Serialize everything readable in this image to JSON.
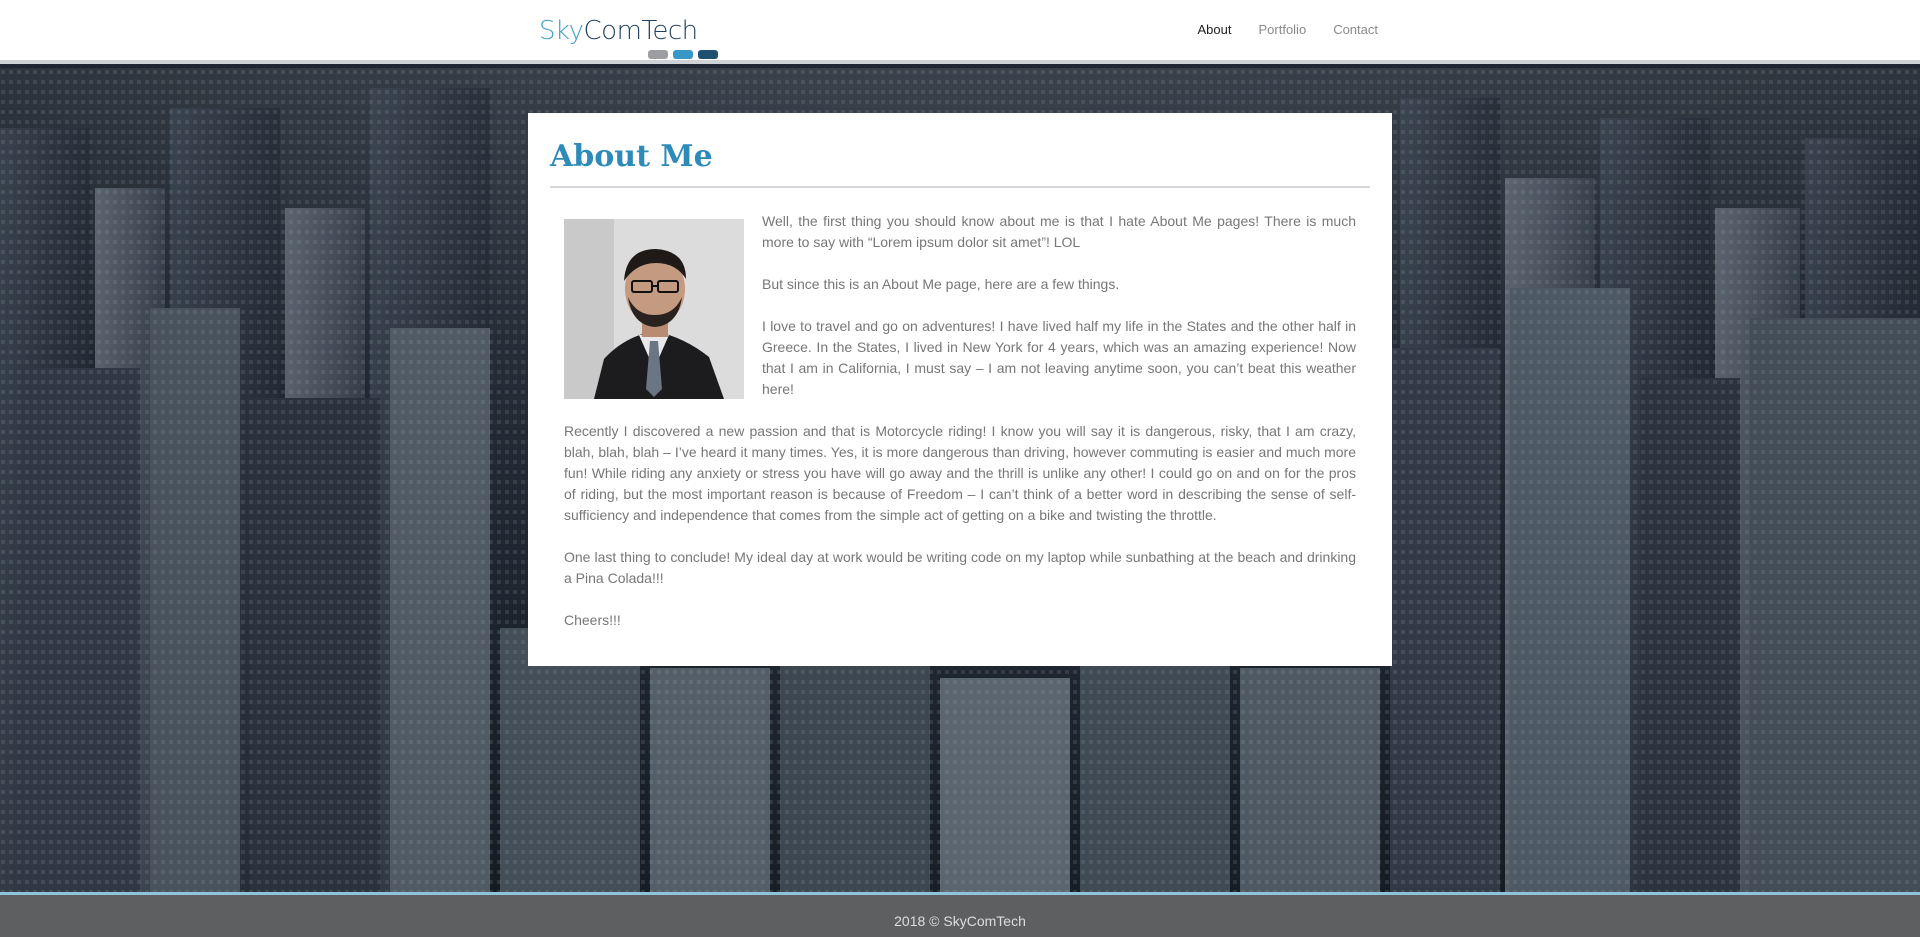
{
  "header": {
    "logo": {
      "part1": "Sky",
      "part2": "ComTech"
    },
    "nav": [
      {
        "label": "About",
        "active": true
      },
      {
        "label": "Portfolio",
        "active": false
      },
      {
        "label": "Contact",
        "active": false
      }
    ]
  },
  "about": {
    "title": "About Me",
    "paragraphs": [
      "Well, the first thing you should know about me is that I hate About Me pages! There is much more to say with “Lorem ipsum dolor sit amet”! LOL",
      "But since this is an About Me page, here are a few things.",
      "I love to travel and go on adventures! I have lived half my life in the States and the other half in Greece. In the States, I lived in New York for 4 years, which was an amazing experience! Now that I am in California, I must say – I am not leaving anytime soon, you can’t beat this weather here!",
      "Recently I discovered a new passion and that is Motorcycle riding! I know you will say it is dangerous, risky, that I am crazy, blah, blah, blah – I’ve heard it many times. Yes, it is more dangerous than driving, however commuting is easier and much more fun! While riding any anxiety or stress you have will go away and the thrill is unlike any other! I could go on and on for the pros of riding, but the most important reason is because of Freedom – I can’t think of a better word in describing the sense of self-sufficiency and independence that comes from the simple act of getting on a bike and twisting the throttle.",
      "One last thing to conclude! My ideal day at work would be writing code on my laptop while sunbathing at the beach and drinking a Pina Colada!!!",
      "Cheers!!!"
    ]
  },
  "footer": {
    "text": "2018 © SkyComTech"
  },
  "colors": {
    "accent": "#2e8ab9",
    "footer_bg": "#5d5f61",
    "footer_border": "#8fc3d9"
  }
}
